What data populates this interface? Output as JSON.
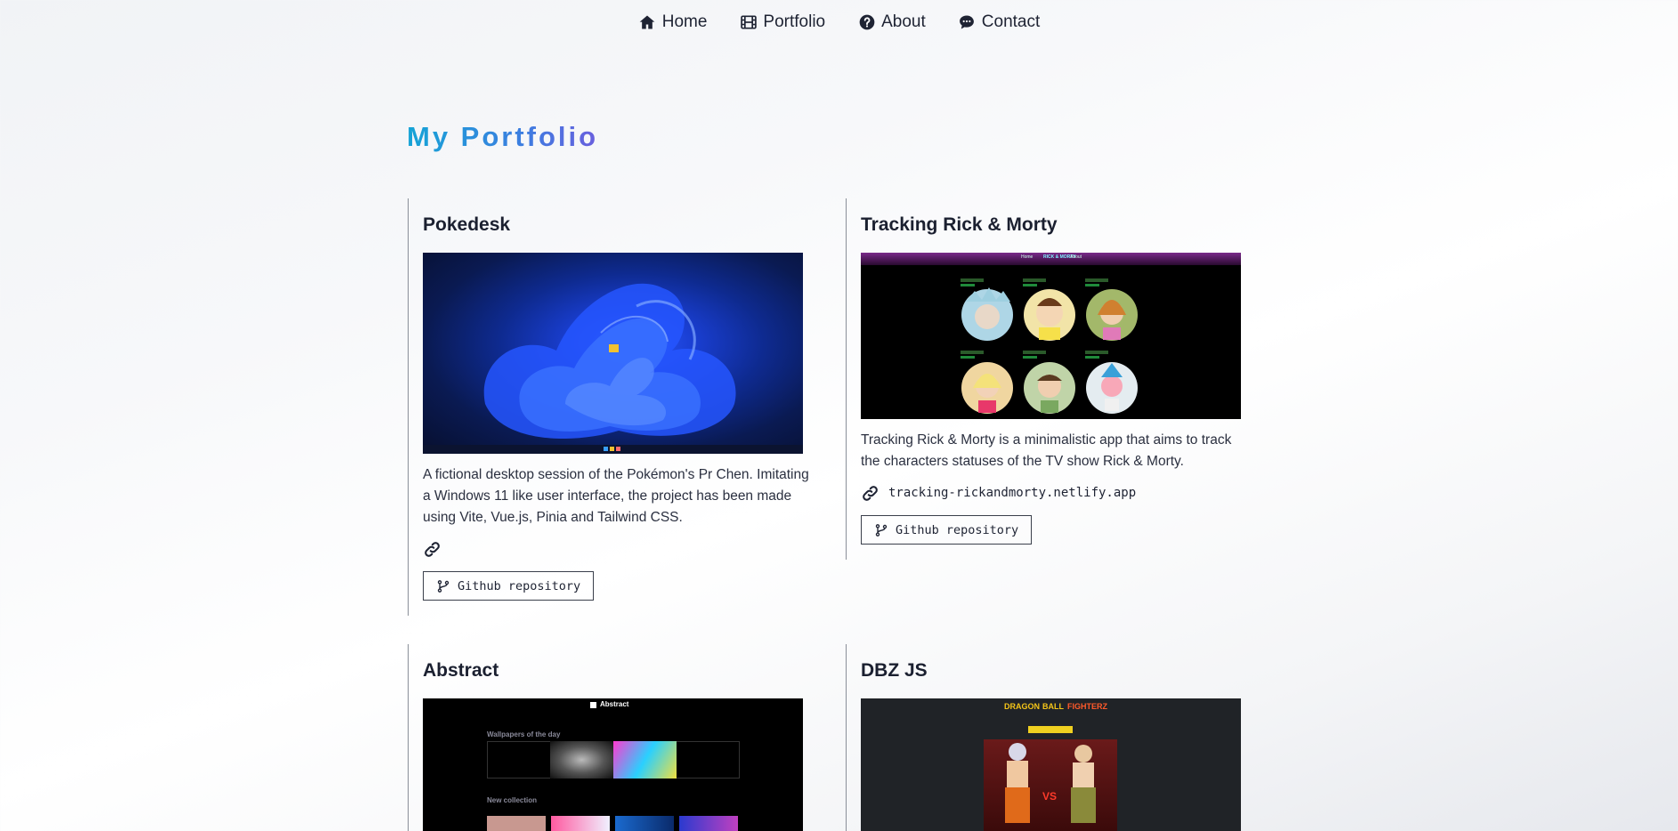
{
  "nav": {
    "items": [
      {
        "label": "Home",
        "icon": "home-icon"
      },
      {
        "label": "Portfolio",
        "icon": "film-icon"
      },
      {
        "label": "About",
        "icon": "question-circle-icon"
      },
      {
        "label": "Contact",
        "icon": "chat-bubble-icon"
      }
    ]
  },
  "page": {
    "title": "My Portfolio"
  },
  "projects": [
    {
      "title": "Pokedesk",
      "description": "A fictional desktop session of the Pokémon's Pr Chen. Imitating a Windows 11 like user interface, the project has been made using Vite, Vue.js, Pinia and Tailwind CSS.",
      "link": "",
      "github_label": "Github repository"
    },
    {
      "title": "Tracking Rick & Morty",
      "description": "Tracking Rick & Morty is a minimalistic app that aims to track the characters statuses of the TV show Rick & Morty.",
      "link": "tracking-rickandmorty.netlify.app",
      "github_label": "Github repository",
      "thumb": {
        "site_title": "RICK & MORTY",
        "nav_home": "Home",
        "nav_about": "About"
      }
    },
    {
      "title": "Abstract",
      "thumb": {
        "brand": "Abstract",
        "heading": "Wallpapers of the day",
        "subheading": "New collection"
      }
    },
    {
      "title": "DBZ JS",
      "thumb": {
        "logo_a": "DRAGON",
        "logo_b": "BALL",
        "logo_c": "FIGHTERZ",
        "vs": "VS"
      }
    }
  ],
  "colors": {
    "title_gradient_start": "#15a4d6",
    "title_gradient_end": "#6a5fde"
  }
}
